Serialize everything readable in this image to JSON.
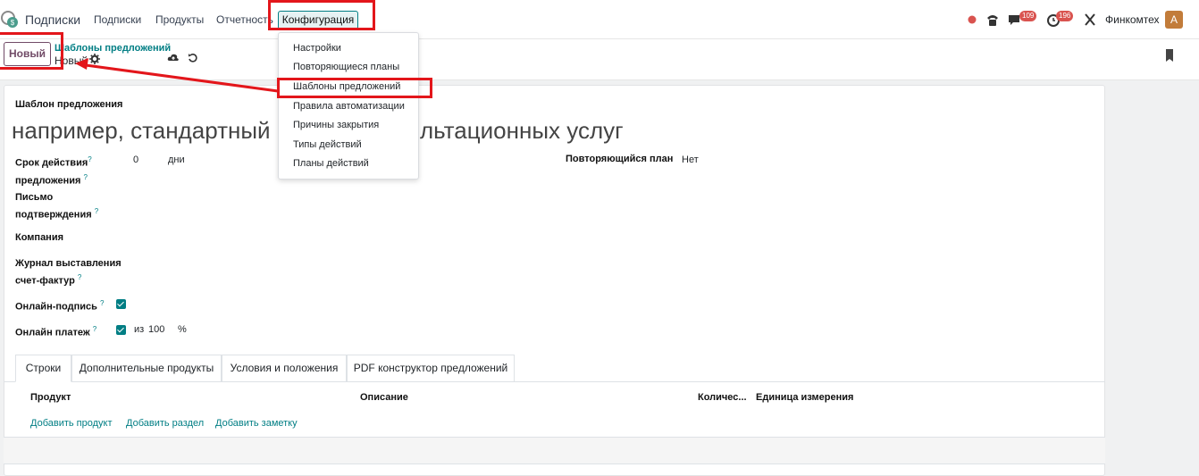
{
  "navbar": {
    "app_name": "Подписки",
    "menu": [
      "Подписки",
      "Продукты",
      "Отчетность"
    ],
    "config_label": "Конфигурация",
    "chat_badge": "109",
    "activity_badge": "196",
    "company": "Финкомтех",
    "avatar_letter": "A",
    "colors": {
      "brand": "#017e84",
      "badge": "#d9534f",
      "record_dot": "#d9534f",
      "avatar": "#c27c3a"
    },
    "icons": [
      "subscriptions-logo-icon",
      "record-dot-icon",
      "phone-icon",
      "chat-icon",
      "clock-icon",
      "tools-icon"
    ]
  },
  "control": {
    "new_button": "Новый",
    "breadcrumb_parent": "Шаблоны предложений",
    "breadcrumb_current": "Новый",
    "icons": [
      "gear-icon",
      "save-cloud-icon",
      "discard-icon",
      "bookmark-icon"
    ]
  },
  "form": {
    "section_title": "Шаблон предложения",
    "name_placeholder_left": "например, стандартный",
    "name_placeholder_right": "льтационных услуг",
    "validity_label_1": "Срок действия",
    "validity_label_2": "предложения",
    "validity_value": "0",
    "validity_unit": "дни",
    "recurring_label": "Повторяющийся план",
    "recurring_value": "Нет",
    "confirm_label_1": "Письмо",
    "confirm_label_2": "подтверждения",
    "company_label": "Компания",
    "journal_label_1": "Журнал выставления",
    "journal_label_2": "счет-фактур",
    "online_sign_label": "Онлайн-подпись",
    "online_sign_checked": true,
    "online_pay_label": "Онлайн платеж",
    "online_pay_checked": true,
    "online_pay_prefix": "из",
    "online_pay_value": "100",
    "online_pay_unit": "%",
    "help_mark": "?"
  },
  "tabs": [
    "Строки",
    "Дополнительные продукты",
    "Условия и положения",
    "PDF конструктор предложений"
  ],
  "table": {
    "headers": [
      "Продукт",
      "Описание",
      "Количес...",
      "Единица измерения"
    ],
    "add_links": [
      "Добавить продукт",
      "Добавить раздел",
      "Добавить заметку"
    ]
  },
  "config_menu": {
    "items": [
      "Настройки",
      "Повторяющиеся планы",
      "Шаблоны предложений",
      "Правила автоматизации",
      "Причины закрытия",
      "Типы действий",
      "Планы действий"
    ],
    "highlighted_item": "Шаблоны предложений"
  },
  "annotation_color": "#e3161b"
}
